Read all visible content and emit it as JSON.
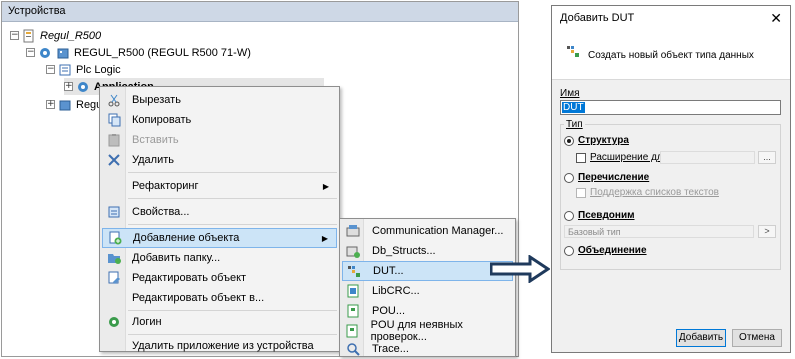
{
  "devices": {
    "title": "Устройства",
    "root": "Regul_R500",
    "device": "REGUL_R500 (REGUL R500 71-W)",
    "plc_logic": "Plc Logic",
    "application": "Application",
    "regul_partial": "Regul"
  },
  "context_menu": {
    "items": [
      {
        "label": "Вырезать",
        "icon": "scissors-icon"
      },
      {
        "label": "Копировать",
        "icon": "copy-icon"
      },
      {
        "label": "Вставить",
        "icon": "paste-icon"
      },
      {
        "label": "Удалить",
        "icon": "delete-x-icon"
      },
      {
        "label": "Рефакторинг",
        "icon": ""
      },
      {
        "label": "Свойства...",
        "icon": "properties-icon"
      },
      {
        "label": "Добавление объекта",
        "icon": "add-object-icon"
      },
      {
        "label": "Добавить папку...",
        "icon": "add-folder-icon"
      },
      {
        "label": "Редактировать объект",
        "icon": "edit-object-icon"
      },
      {
        "label": "Редактировать объект в...",
        "icon": ""
      },
      {
        "label": "Логин",
        "icon": "login-gear-icon"
      },
      {
        "label": "Удалить приложение из устройства",
        "icon": ""
      }
    ]
  },
  "submenu": {
    "items": [
      {
        "label": "Communication Manager...",
        "icon": "comm-manager-icon"
      },
      {
        "label": "Db_Structs...",
        "icon": "db-structs-icon"
      },
      {
        "label": "DUT...",
        "icon": "dut-icon"
      },
      {
        "label": "LibCRC...",
        "icon": "libcrc-icon"
      },
      {
        "label": "POU...",
        "icon": "pou-icon"
      },
      {
        "label": "POU для неявных проверок...",
        "icon": "pou-implicit-icon"
      },
      {
        "label": "Trace...",
        "icon": "trace-icon"
      }
    ]
  },
  "dialog": {
    "title": "Добавить DUT",
    "close": "✕",
    "description": "Создать новый объект типа данных",
    "name_label": "Имя",
    "name_value": "DUT",
    "type_label": "Тип",
    "structure": "Структура",
    "extension": "Расширение для",
    "browse": "...",
    "enumeration": "Перечисление",
    "text_list_support": "Поддержка списков текстов",
    "alias": "Псевдоним",
    "base_type": "Базовый тип",
    "base_type_btn": ">",
    "union": "Объединение",
    "add_button": "Добавить",
    "cancel_button": "Отмена"
  },
  "colors": {
    "highlight": "#cce4f7",
    "highlight_border": "#7eb4ea",
    "title_bg": "#ced8e6",
    "arrow": "#1f3a5c"
  }
}
